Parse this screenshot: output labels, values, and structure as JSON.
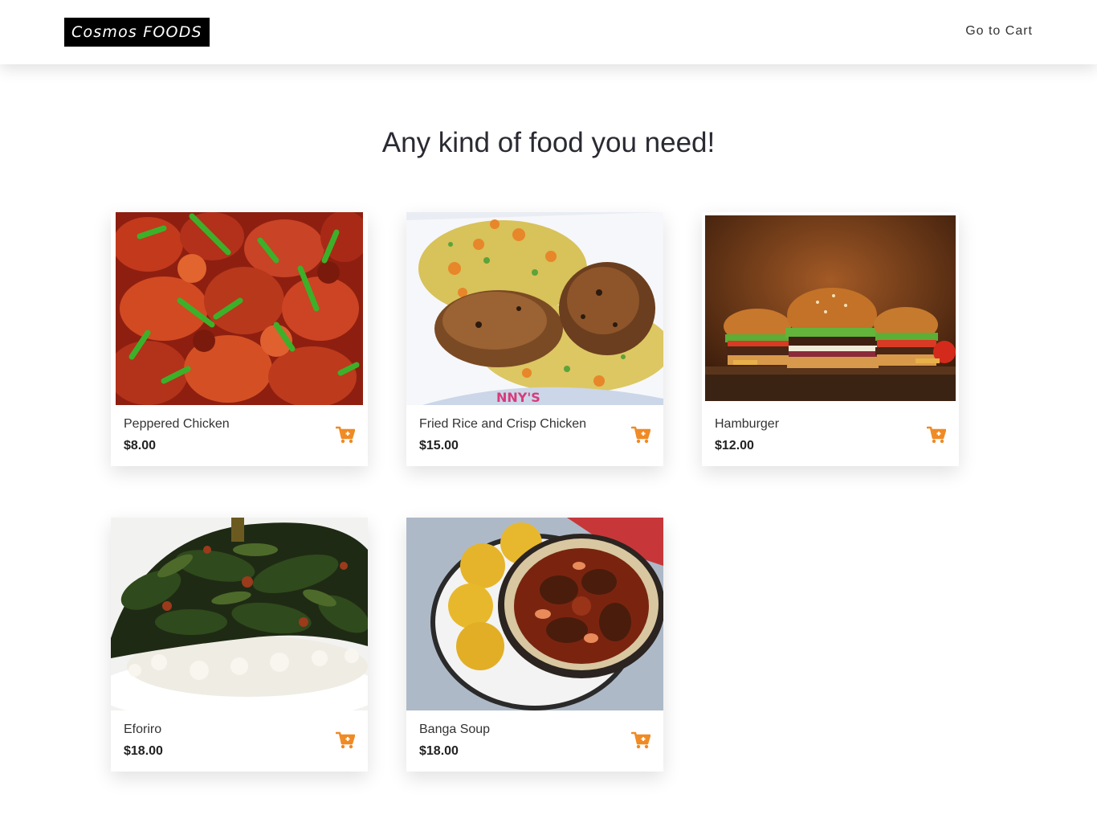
{
  "nav": {
    "brand": "Cosmos FOODS",
    "cart_link": "Go to Cart"
  },
  "main": {
    "headline": "Any kind of food you need!"
  },
  "accent_color": "#f08a24",
  "products": [
    {
      "name": "Peppered Chicken",
      "price": "$8.00",
      "image": "peppered-chicken-image"
    },
    {
      "name": "Fried Rice and Crisp Chicken",
      "price": "$15.00",
      "image": "fried-rice-chicken-image",
      "image_text": "NNY'S"
    },
    {
      "name": "Hamburger",
      "price": "$12.00",
      "image": "hamburger-image"
    },
    {
      "name": "Eforiro",
      "price": "$18.00",
      "image": "eforiro-image"
    },
    {
      "name": "Banga Soup",
      "price": "$18.00",
      "image": "banga-soup-image"
    }
  ]
}
